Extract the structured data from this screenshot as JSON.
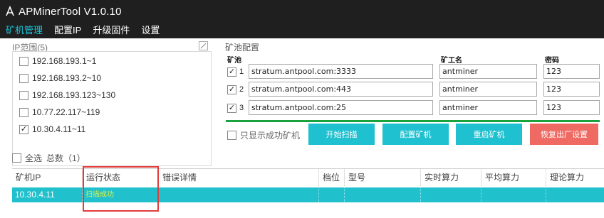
{
  "titlebar": {
    "title": "APMinerTool V1.0.10"
  },
  "menu": [
    {
      "label": "矿机管理",
      "active": true
    },
    {
      "label": "配置IP",
      "active": false
    },
    {
      "label": "升级固件",
      "active": false
    },
    {
      "label": "设置",
      "active": false
    }
  ],
  "ip_panel": {
    "header": "IP范围(5)",
    "items": [
      {
        "label": "192.168.193.1~1",
        "checked": false
      },
      {
        "label": "192.168.193.2~10",
        "checked": false
      },
      {
        "label": "192.168.193.123~130",
        "checked": false
      },
      {
        "label": "10.77.22.117~119",
        "checked": false
      },
      {
        "label": "10.30.4.11~11",
        "checked": true
      }
    ]
  },
  "pool_panel": {
    "header": "矿池配置",
    "col_pool": "矿池",
    "col_worker": "矿工名",
    "col_password": "密码",
    "rows": [
      {
        "num": "1",
        "checked": true,
        "pool": "stratum.antpool.com:3333",
        "worker": "antminer",
        "password": "123"
      },
      {
        "num": "2",
        "checked": true,
        "pool": "stratum.antpool.com:443",
        "worker": "antminer",
        "password": "123"
      },
      {
        "num": "3",
        "checked": true,
        "pool": "stratum.antpool.com:25",
        "worker": "antminer",
        "password": "123"
      }
    ]
  },
  "controls": {
    "only_success": "只显示成功矿机",
    "start_scan": "开始扫描",
    "config_miner": "配置矿机",
    "restart_miner": "重启矿机",
    "factory_reset": "恢复出厂设置"
  },
  "selection": {
    "select_all": "全选",
    "total": "总数（1）"
  },
  "table": {
    "columns": [
      "矿机IP",
      "运行状态",
      "错误详情",
      "档位",
      "型号",
      "实时算力",
      "平均算力",
      "理论算力"
    ],
    "rows": [
      {
        "ip": "10.30.4.11",
        "status": "扫描成功",
        "error": "",
        "level": "",
        "model": "",
        "realtime": "",
        "average": "",
        "theoretical": ""
      }
    ]
  },
  "colors": {
    "accent": "#19c0d6",
    "row_highlight": "#20c0cc",
    "button_cyan": "#1fc0cf",
    "button_red": "#ef6a63",
    "status_text": "#d8f04a",
    "highlight_box": "#e23b3b"
  }
}
